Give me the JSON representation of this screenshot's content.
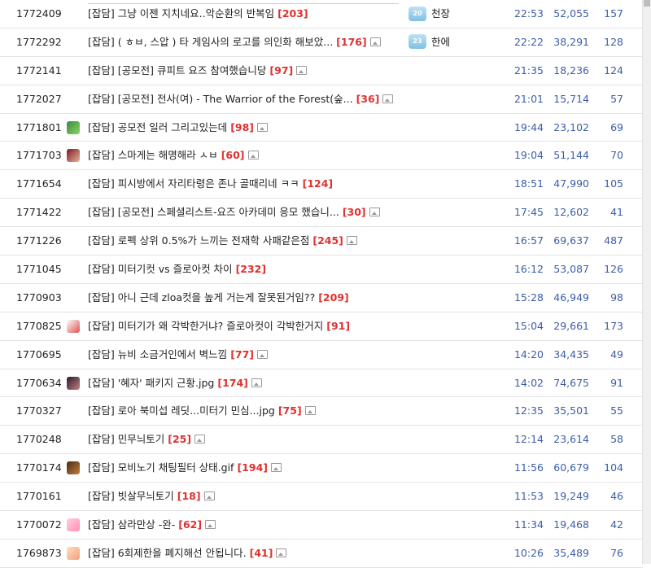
{
  "colors": {
    "comment": "#e03030",
    "meta": "#3b5da8",
    "row_border": "#e4e4e4"
  },
  "rows": [
    {
      "num": "1772409",
      "subject": "[잡담] 그냥 이젠 지치네요..악순환의 반복임",
      "comments": "[203]",
      "image": false,
      "author": "천장",
      "level_badge": "20",
      "avatar": "",
      "time": "22:53",
      "views": "52,055",
      "likes": "157"
    },
    {
      "num": "1772292",
      "subject": "[잡담] ( ㅎㅂ, 스압 ) 타 게임사의 로고를 의인화 해보았...",
      "comments": "[176]",
      "image": true,
      "author": "한에",
      "level_badge": "23",
      "avatar": "",
      "time": "22:22",
      "views": "38,291",
      "likes": "128"
    },
    {
      "num": "1772141",
      "subject": "[잡담] [공모전] 큐피트 요즈 참여했습니당",
      "comments": "[97]",
      "image": true,
      "author": "",
      "level_badge": "",
      "avatar": "",
      "time": "21:35",
      "views": "18,236",
      "likes": "124"
    },
    {
      "num": "1772027",
      "subject": "[잡담] [공모전] 전사(여) - The Warrior of the Forest(숲...",
      "comments": "[36]",
      "image": true,
      "author": "",
      "level_badge": "",
      "avatar": "",
      "time": "21:01",
      "views": "15,714",
      "likes": "57"
    },
    {
      "num": "1771801",
      "subject": "[잡담] 공모전 일러 그리고있는데",
      "comments": "[98]",
      "image": true,
      "author": "",
      "level_badge": "",
      "avatar": "green",
      "time": "19:44",
      "views": "23,102",
      "likes": "69"
    },
    {
      "num": "1771703",
      "subject": "[잡담] 스마게는 해명해라 ㅅㅂ",
      "comments": "[60]",
      "image": true,
      "author": "",
      "level_badge": "",
      "avatar": "red",
      "time": "19:04",
      "views": "51,144",
      "likes": "70"
    },
    {
      "num": "1771654",
      "subject": "[잡담] 피시방에서 자리타령은 존나 골때리네 ㅋㅋ",
      "comments": "[124]",
      "image": false,
      "author": "",
      "level_badge": "",
      "avatar": "",
      "time": "18:51",
      "views": "47,990",
      "likes": "105"
    },
    {
      "num": "1771422",
      "subject": "[잡담] [공모전] 스페셜리스트-요즈 아카데미 응모 했습니...",
      "comments": "[30]",
      "image": true,
      "author": "",
      "level_badge": "",
      "avatar": "",
      "time": "17:45",
      "views": "12,602",
      "likes": "41"
    },
    {
      "num": "1771226",
      "subject": "[잡담] 로펙 상위 0.5%가 느끼는 전재학 사패같은점",
      "comments": "[245]",
      "image": true,
      "author": "",
      "level_badge": "",
      "avatar": "",
      "time": "16:57",
      "views": "69,637",
      "likes": "487"
    },
    {
      "num": "1771045",
      "subject": "[잡담] 미터기컷 vs 즐로아컷 차이",
      "comments": "[232]",
      "image": false,
      "author": "",
      "level_badge": "",
      "avatar": "",
      "time": "16:12",
      "views": "53,087",
      "likes": "126"
    },
    {
      "num": "1770903",
      "subject": "[잡담] 아니 근데 zloa컷을 높게 거는게 잘못된거임??",
      "comments": "[209]",
      "image": false,
      "author": "",
      "level_badge": "",
      "avatar": "",
      "time": "15:28",
      "views": "46,949",
      "likes": "98"
    },
    {
      "num": "1770825",
      "subject": "[잡담] 미터기가 왜 각박한거냐? 즐로아컷이 각박한거지",
      "comments": "[91]",
      "image": false,
      "author": "",
      "level_badge": "",
      "avatar": "candy",
      "time": "15:04",
      "views": "29,661",
      "likes": "173"
    },
    {
      "num": "1770695",
      "subject": "[잡담] 뉴비 소금거인에서 벽느낌",
      "comments": "[77]",
      "image": true,
      "author": "",
      "level_badge": "",
      "avatar": "",
      "time": "14:20",
      "views": "34,435",
      "likes": "49"
    },
    {
      "num": "1770634",
      "subject": "[잡담] '혜자' 패키지 근황.jpg",
      "comments": "[174]",
      "image": true,
      "author": "",
      "level_badge": "",
      "avatar": "dark",
      "time": "14:02",
      "views": "74,675",
      "likes": "91"
    },
    {
      "num": "1770327",
      "subject": "[잡담] 로아 북미섭 레딧...미터기 민심...jpg",
      "comments": "[75]",
      "image": true,
      "author": "",
      "level_badge": "",
      "avatar": "",
      "time": "12:35",
      "views": "35,501",
      "likes": "55"
    },
    {
      "num": "1770248",
      "subject": "[잡담] 민무늬토기",
      "comments": "[25]",
      "image": true,
      "author": "",
      "level_badge": "",
      "avatar": "",
      "time": "12:14",
      "views": "23,614",
      "likes": "58"
    },
    {
      "num": "1770174",
      "subject": "[잡담] 모비노기 채팅필터 상태.gif",
      "comments": "[194]",
      "image": true,
      "author": "",
      "level_badge": "",
      "avatar": "brown",
      "time": "11:56",
      "views": "60,679",
      "likes": "104"
    },
    {
      "num": "1770161",
      "subject": "[잡담] 빗살무늬토기",
      "comments": "[18]",
      "image": true,
      "author": "",
      "level_badge": "",
      "avatar": "",
      "time": "11:53",
      "views": "19,249",
      "likes": "46"
    },
    {
      "num": "1770072",
      "subject": "[잡담] 삼라만상 -완-",
      "comments": "[62]",
      "image": true,
      "author": "",
      "level_badge": "",
      "avatar": "pink",
      "time": "11:34",
      "views": "19,468",
      "likes": "42"
    },
    {
      "num": "1769873",
      "subject": "[잡담] 6회제한을 폐지해선 안됩니다.",
      "comments": "[41]",
      "image": true,
      "author": "",
      "level_badge": "",
      "avatar": "peach",
      "time": "10:26",
      "views": "35,489",
      "likes": "76"
    }
  ]
}
